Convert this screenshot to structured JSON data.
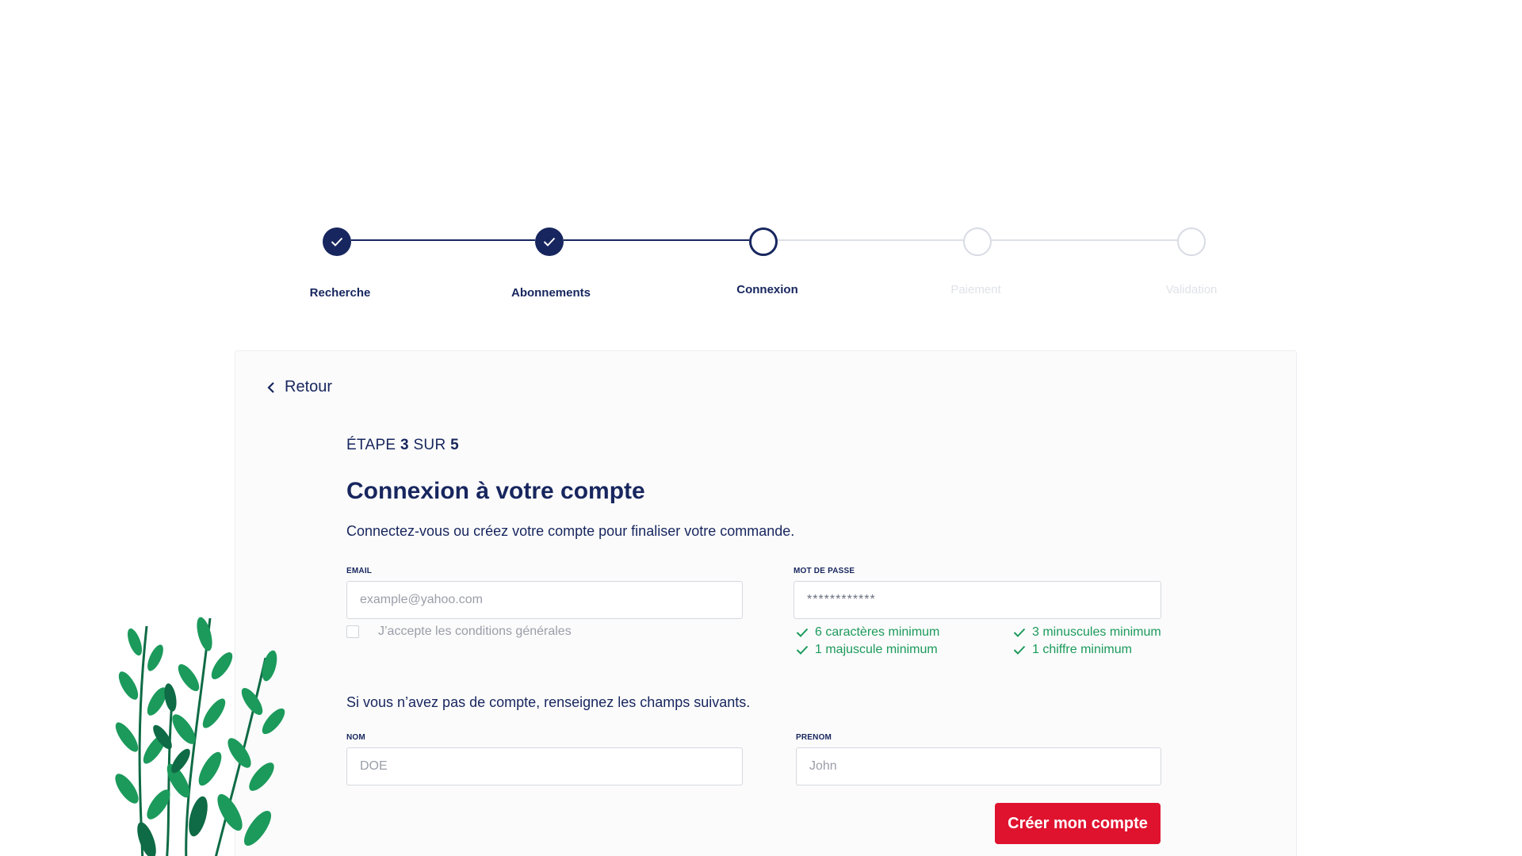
{
  "stepper": {
    "steps": [
      {
        "label": "Recherche",
        "state": "done"
      },
      {
        "label": "Abonnements",
        "state": "done"
      },
      {
        "label": "Connexion",
        "state": "current"
      },
      {
        "label": "Paiement",
        "state": "todo"
      },
      {
        "label": "Validation",
        "state": "todo"
      }
    ]
  },
  "card": {
    "back_label": "Retour",
    "step_counter": {
      "prefix": "ÉTAPE",
      "current": "3",
      "sep": "SUR",
      "total": "5"
    },
    "title": "Connexion à votre compte",
    "subtitle": "Connectez-vous ou créez votre compte pour finaliser votre commande.",
    "email": {
      "label": "EMAIL",
      "placeholder": "example@yahoo.com"
    },
    "password": {
      "label": "MOT DE PASSE",
      "value": "************"
    },
    "terms_label": "J’accepte les conditions générales",
    "password_rules": [
      "6 caractères minimum",
      "3 minuscules minimum",
      "1 majuscule minimum",
      "1 chiffre minimum"
    ],
    "no_account_text": "Si vous n’avez pas de compte, renseignez les champs suivants.",
    "nom": {
      "label": "NOM",
      "placeholder": "DOE"
    },
    "prenom": {
      "label": "PRENOM",
      "placeholder": "John"
    },
    "create_button": "Créer mon compte"
  },
  "colors": {
    "navy": "#17265e",
    "accent_red": "#e0132f",
    "success_green": "#1b9a5b",
    "inactive_grey": "#dfe2e8"
  }
}
